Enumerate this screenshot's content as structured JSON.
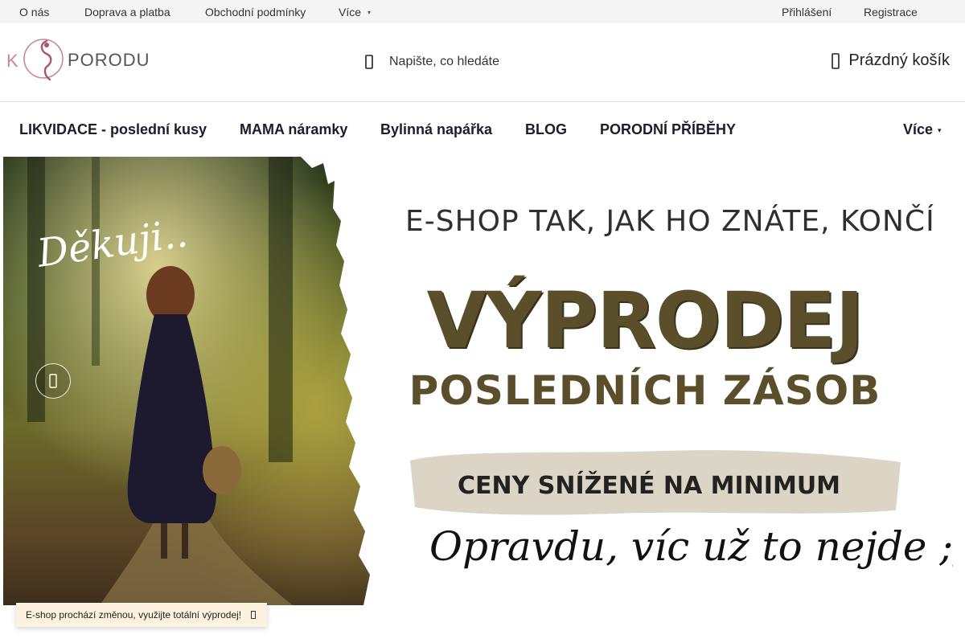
{
  "topbar": {
    "links": [
      "O nás",
      "Doprava a platba",
      "Obchodní podmínky",
      "Více"
    ],
    "more_icon": "chevron-down-icon",
    "login": "Přihlášení",
    "register": "Registrace"
  },
  "header": {
    "logo_text": "PORODU",
    "logo_k": "K",
    "search_placeholder": "Napište, co hledáte",
    "search_icon": "search-icon",
    "cart_label": "Prázdný košík",
    "cart_icon": "cart-icon"
  },
  "nav": {
    "items": [
      "LIKVIDACE - poslední kusy",
      "MAMA náramky",
      "Bylinná napářka",
      "BLOG",
      "PORODNÍ PŘÍBĚHY"
    ],
    "more": "Více",
    "more_icon": "chevron-down-icon"
  },
  "banner": {
    "dekuji": "Děkuji..",
    "eshop": "E-SHOP TAK, JAK HO ZNÁTE, KONČÍ",
    "vyprodej": "VÝPRODEJ",
    "poslednich": "POSLEDNÍCH ZÁSOB",
    "ceny": "CENY SNÍŽENÉ NA MINIMUM",
    "opravdu": "Opravdu, víc už to nejde ;)",
    "prev_icon": "chevron-left-icon"
  },
  "notice": {
    "text": "E-shop prochází změnou, využijte totální výprodej!",
    "close_icon": "close-icon"
  },
  "colors": {
    "banner_headline": "#5a4e2b",
    "logo_pink": "#c9869a",
    "notice_bg": "#fdf2df"
  }
}
